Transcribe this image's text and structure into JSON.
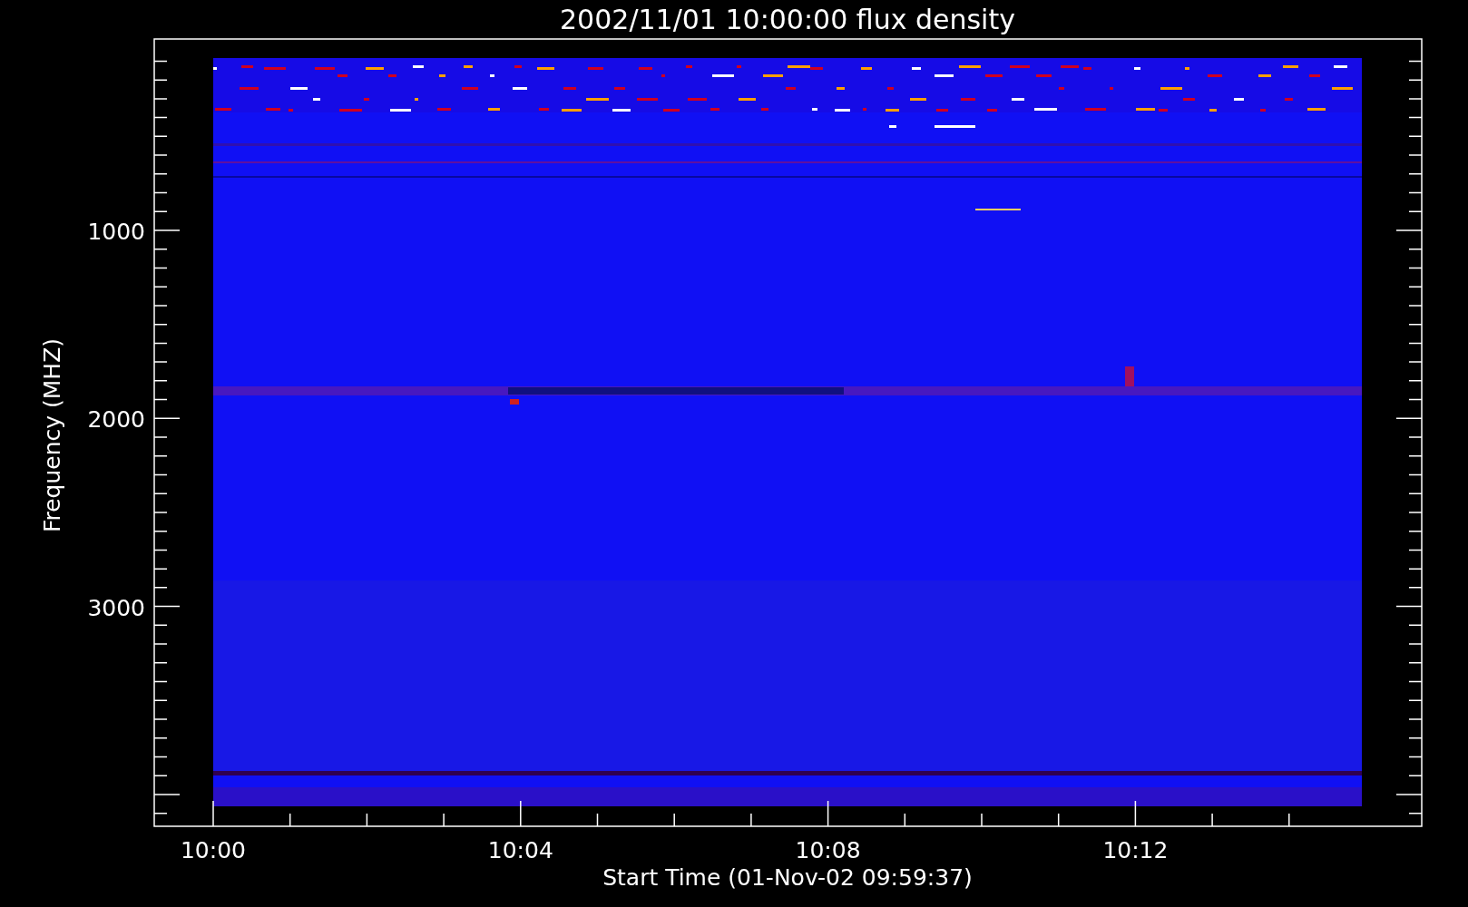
{
  "title": "2002/11/01 10:00:00 flux density",
  "xlabel": "Start Time (01-Nov-02 09:59:37)",
  "ylabel": "Frequency (MHZ)",
  "xticks": [
    "10:00",
    "10:04",
    "10:08",
    "10:12"
  ],
  "yticks": [
    "1000",
    "2000",
    "3000"
  ]
}
